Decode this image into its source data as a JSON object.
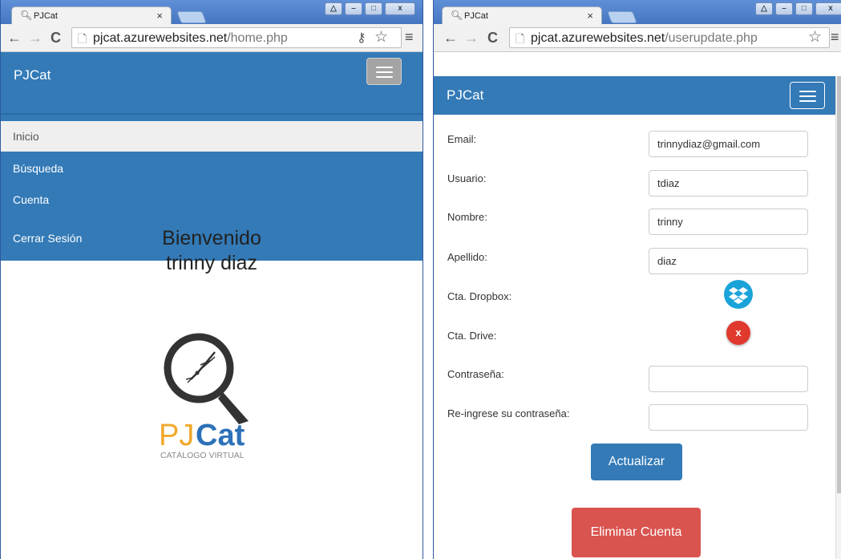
{
  "colors": {
    "navbar": "#337ab7",
    "danger": "#d9534f",
    "dropbox": "#1aa3d9",
    "drive_error": "#e03a2f"
  },
  "left": {
    "tab_title": "PJCat",
    "tab_close": "×",
    "url_host": "pjcat.azurewebsites.net",
    "url_path": "/home.php",
    "brand": "PJCat",
    "nav_items": [
      "Inicio",
      "Búsqueda",
      "Cuenta",
      "Cerrar Sesión"
    ],
    "welcome_line1": "Bienvenido",
    "welcome_line2": "trinny diaz",
    "logo_pj": "PJ",
    "logo_cat": "Cat",
    "logo_sub": "CATÁLOGO VIRTUAL"
  },
  "right": {
    "tab_title": "PJCat",
    "tab_close": "×",
    "url_host": "pjcat.azurewebsites.net",
    "url_path": "/userupdate.php",
    "brand": "PJCat",
    "form": {
      "email_label": "Email:",
      "email_value": "trinnydiaz@gmail.com",
      "user_label": "Usuario:",
      "user_value": "tdiaz",
      "name_label": "Nombre:",
      "name_value": "trinny",
      "surname_label": "Apellido:",
      "surname_value": "diaz",
      "dropbox_label": "Cta. Dropbox:",
      "drive_label": "Cta. Drive:",
      "drive_status": "x",
      "password_label": "Contraseña:",
      "password_value": "",
      "repassword_label": "Re-ingrese su contraseña:",
      "repassword_value": ""
    },
    "update_button": "Actualizar",
    "delete_button": "Eliminar Cuenta"
  },
  "icons": {
    "tab_favicon": "magnifier-icon",
    "back": "←",
    "forward": "→",
    "reload": "C",
    "page": "🗋",
    "key": "key-icon",
    "star": "☆",
    "menu": "≡",
    "profile": "person-icon",
    "minimize": "–",
    "maximize": "□",
    "close": "x"
  }
}
